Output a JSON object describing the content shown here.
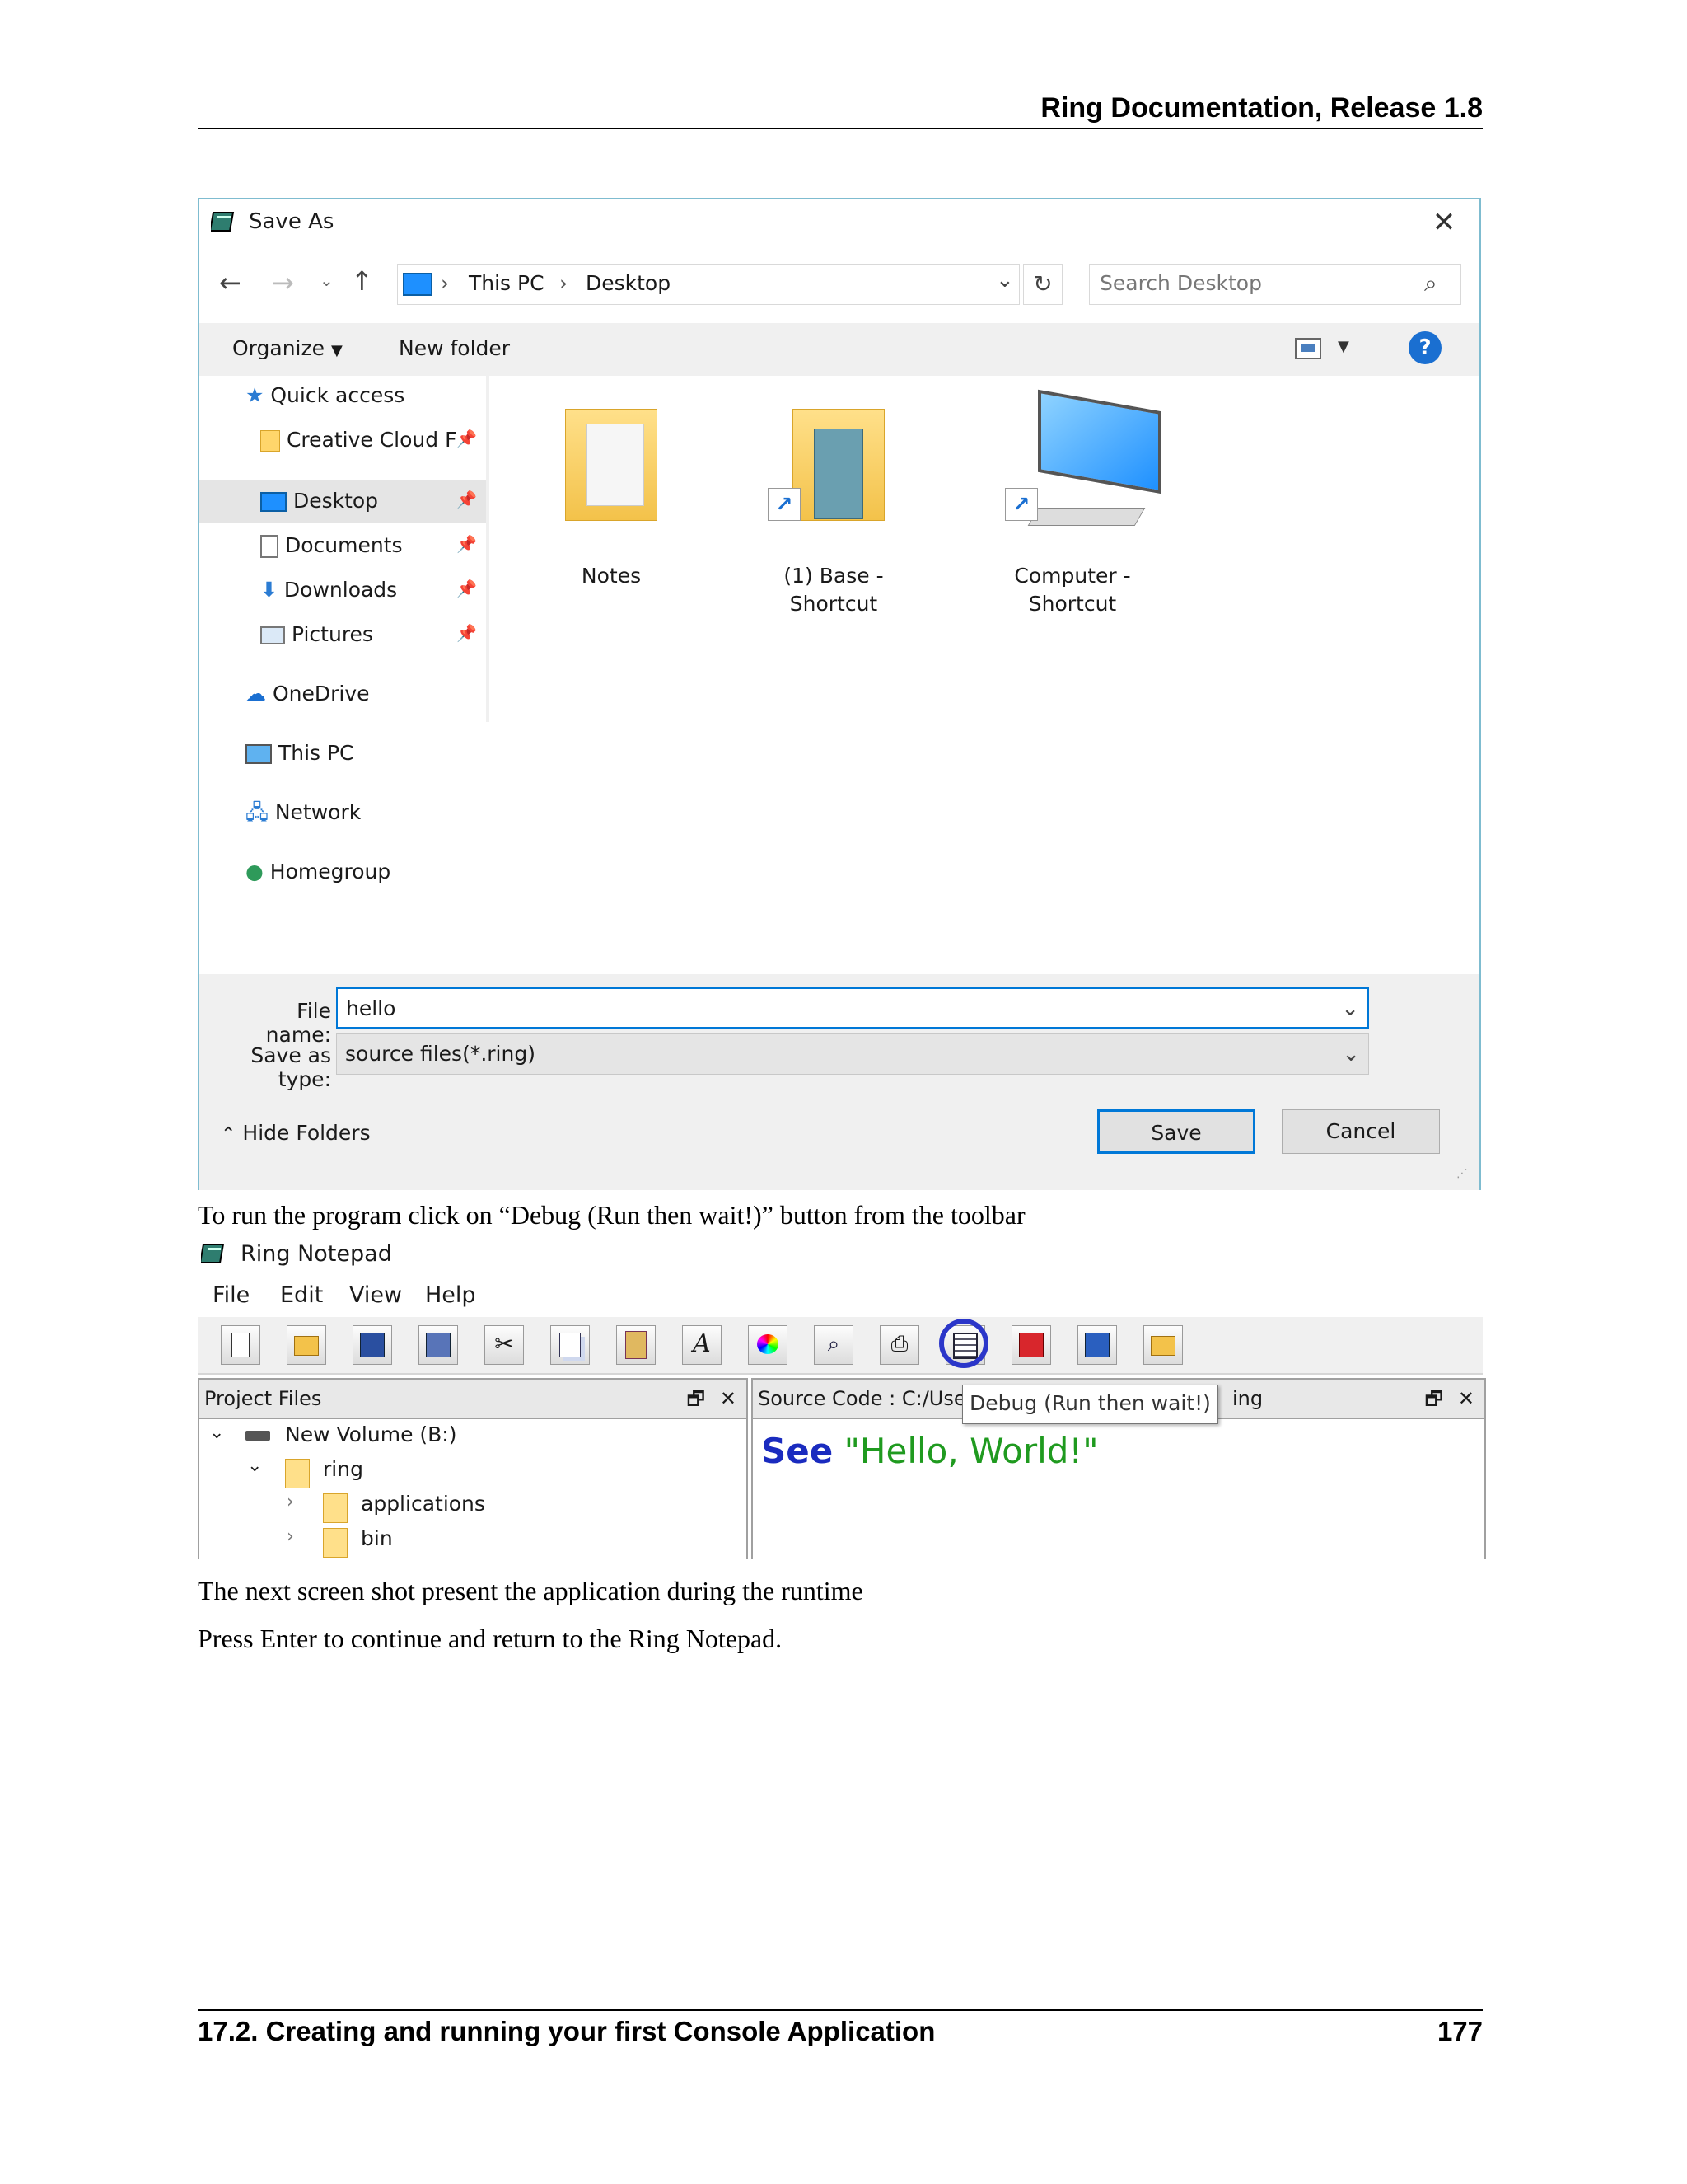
{
  "header": {
    "title": "Ring Documentation, Release 1.8"
  },
  "save_dialog": {
    "title": "Save As",
    "close_icon": "close-icon",
    "nav_buttons": [
      "back-arrow-icon",
      "forward-arrow-icon",
      "recent-dropdown-icon",
      "up-arrow-icon"
    ],
    "breadcrumb": [
      "This PC",
      "Desktop"
    ],
    "search_placeholder": "Search Desktop",
    "toolbar": {
      "organize": "Organize",
      "new_folder": "New folder"
    },
    "nav_pane": [
      {
        "label": "Quick access",
        "icon": "star-icon"
      },
      {
        "label": "Creative Cloud F",
        "icon": "folder-icon",
        "pinned": true
      },
      {
        "label": "Desktop",
        "icon": "desktop-icon",
        "pinned": true,
        "selected": true
      },
      {
        "label": "Documents",
        "icon": "documents-icon",
        "pinned": true
      },
      {
        "label": "Downloads",
        "icon": "download-icon",
        "pinned": true
      },
      {
        "label": "Pictures",
        "icon": "pictures-icon",
        "pinned": true
      },
      {
        "label": "OneDrive",
        "icon": "cloud-icon"
      },
      {
        "label": "This PC",
        "icon": "computer-icon"
      },
      {
        "label": "Network",
        "icon": "network-icon"
      },
      {
        "label": "Homegroup",
        "icon": "homegroup-icon"
      }
    ],
    "files": [
      {
        "name": "Notes",
        "type": "folder"
      },
      {
        "name_line1": "(1) Base -",
        "name_line2": "Shortcut",
        "type": "folder-shortcut"
      },
      {
        "name_line1": "Computer -",
        "name_line2": "Shortcut",
        "type": "computer-shortcut"
      }
    ],
    "file_name_label": "File name:",
    "file_name_value": "hello",
    "save_as_type_label": "Save as type:",
    "save_as_type_value": "source files(*.ring)",
    "hide_folders": "Hide Folders",
    "save_button": "Save",
    "cancel_button": "Cancel"
  },
  "text1": "To run the program click on “Debug (Run then wait!)” button from the toolbar",
  "notepad": {
    "title": "Ring Notepad",
    "menu": [
      "File",
      "Edit",
      "View",
      "Help"
    ],
    "tooltip": "Debug (Run then wait!)",
    "project_files": {
      "title": "Project Files",
      "tree": [
        "New Volume (B:)",
        "ring",
        "applications",
        "bin"
      ]
    },
    "source_code": {
      "title_left": "Source Code : C:/Use",
      "title_right": "ing",
      "code_keyword": "See",
      "code_string": "\"Hello, World!\""
    }
  },
  "text2": "The next screen shot present the application during the runtime",
  "text3": "Press Enter to continue and return to the Ring Notepad.",
  "footer": {
    "section": "17.2.  Creating and running your first Console Application",
    "page": "177"
  }
}
